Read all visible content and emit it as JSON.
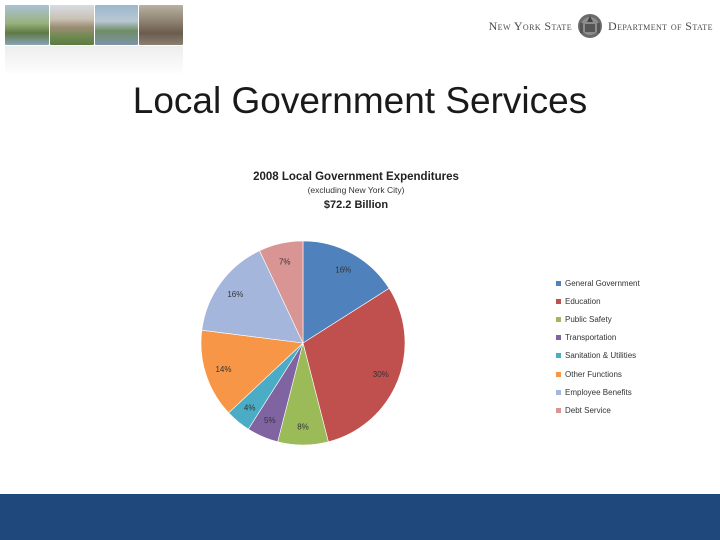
{
  "header": {
    "brand_left": "New York State",
    "brand_right": "Department of State"
  },
  "slide": {
    "title": "Local Government Services"
  },
  "chart_data": {
    "type": "pie",
    "title": "2008 Local Government Expenditures",
    "subtitle": "(excluding New York City)",
    "total_label": "$72.2 Billion",
    "categories": [
      "General Government",
      "Education",
      "Public Safety",
      "Transportation",
      "Sanitation & Utilities",
      "Other Functions",
      "Employee Benefits",
      "Debt Service"
    ],
    "values": [
      16,
      30,
      8,
      5,
      4,
      14,
      16,
      7
    ],
    "value_labels": [
      "16%",
      "30%",
      "8%",
      "5%",
      "4%",
      "14%",
      "16%",
      "7%"
    ],
    "colors": [
      "#4f81bd",
      "#c0504d",
      "#9bbb59",
      "#8064a2",
      "#4bacc6",
      "#f79646",
      "#a5b6dc",
      "#d99594"
    ],
    "legend_position": "right"
  }
}
